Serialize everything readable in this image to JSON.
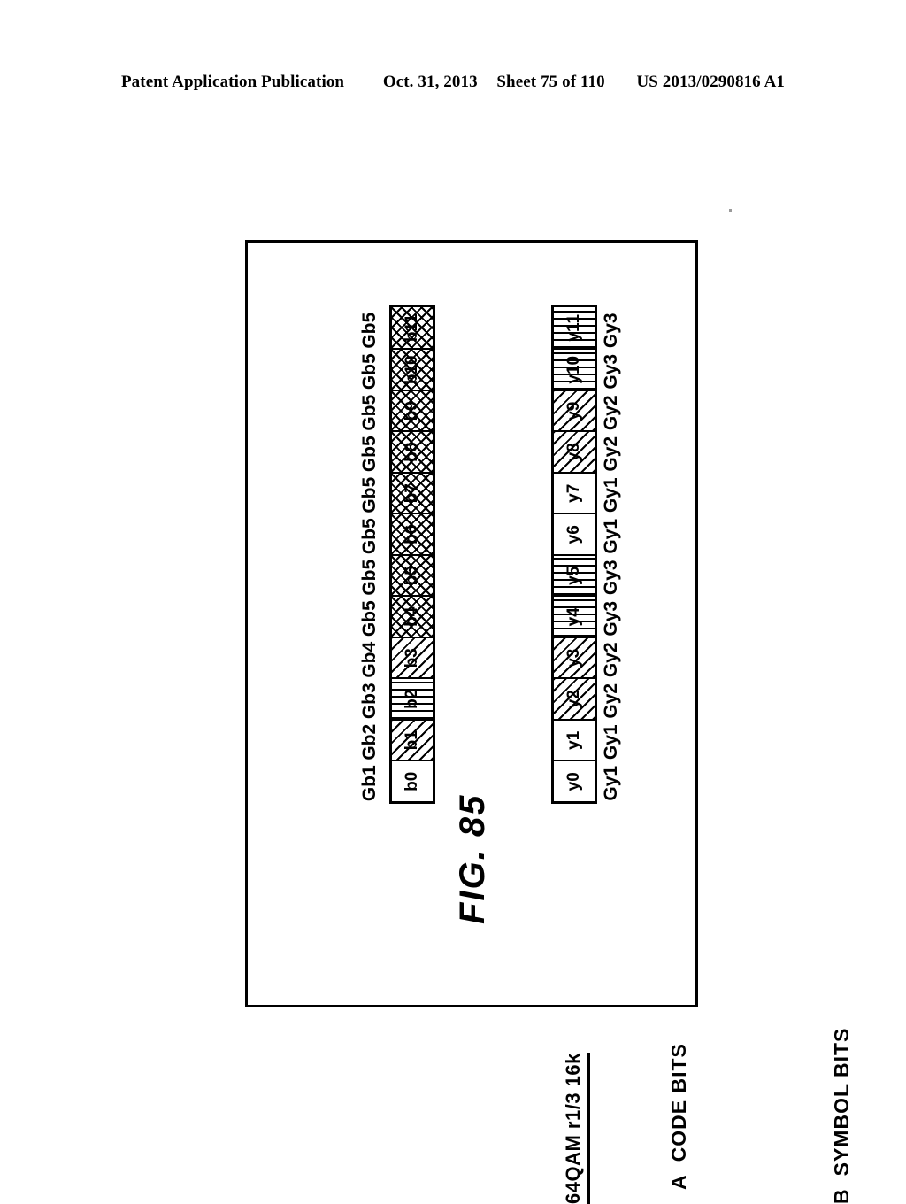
{
  "page_header": {
    "publication": "Patent Application Publication",
    "date": "Oct. 31, 2013",
    "sheet": "Sheet 75 of 110",
    "doc_number": "US 2013/0290816 A1"
  },
  "figure": {
    "title": "FIG. 85",
    "mode_caption": "64QAM r1/3 16k",
    "row_a": {
      "letter": "A",
      "label": "CODE BITS",
      "cells": [
        {
          "label": "b0",
          "fill": "plain"
        },
        {
          "label": "b1",
          "fill": "diag"
        },
        {
          "label": "b2",
          "fill": "vert"
        },
        {
          "label": "b3",
          "fill": "diag"
        },
        {
          "label": "b4",
          "fill": "cross"
        },
        {
          "label": "b5",
          "fill": "cross"
        },
        {
          "label": "b6",
          "fill": "cross"
        },
        {
          "label": "b7",
          "fill": "cross"
        },
        {
          "label": "b8",
          "fill": "cross"
        },
        {
          "label": "b9",
          "fill": "cross"
        },
        {
          "label": "b10",
          "fill": "cross"
        },
        {
          "label": "b11",
          "fill": "cross"
        }
      ],
      "group_labels": [
        "Gb1",
        "Gb2",
        "Gb3",
        "Gb4",
        "Gb5",
        "Gb5",
        "Gb5",
        "Gb5",
        "Gb5",
        "Gb5",
        "Gb5",
        "Gb5"
      ]
    },
    "row_b": {
      "letter": "B",
      "label": "SYMBOL BITS",
      "cells": [
        {
          "label": "y0",
          "fill": "plain"
        },
        {
          "label": "y1",
          "fill": "plain"
        },
        {
          "label": "y2",
          "fill": "diag"
        },
        {
          "label": "y3",
          "fill": "diag"
        },
        {
          "label": "y4",
          "fill": "vert"
        },
        {
          "label": "y5",
          "fill": "vert"
        },
        {
          "label": "y6",
          "fill": "plain"
        },
        {
          "label": "y7",
          "fill": "plain"
        },
        {
          "label": "y8",
          "fill": "diag"
        },
        {
          "label": "y9",
          "fill": "diag"
        },
        {
          "label": "y10",
          "fill": "vert"
        },
        {
          "label": "y11",
          "fill": "vert"
        }
      ],
      "group_labels": [
        "Gy1",
        "Gy1",
        "Gy2",
        "Gy2",
        "Gy3",
        "Gy3",
        "Gy1",
        "Gy1",
        "Gy2",
        "Gy2",
        "Gy3",
        "Gy3"
      ]
    }
  }
}
